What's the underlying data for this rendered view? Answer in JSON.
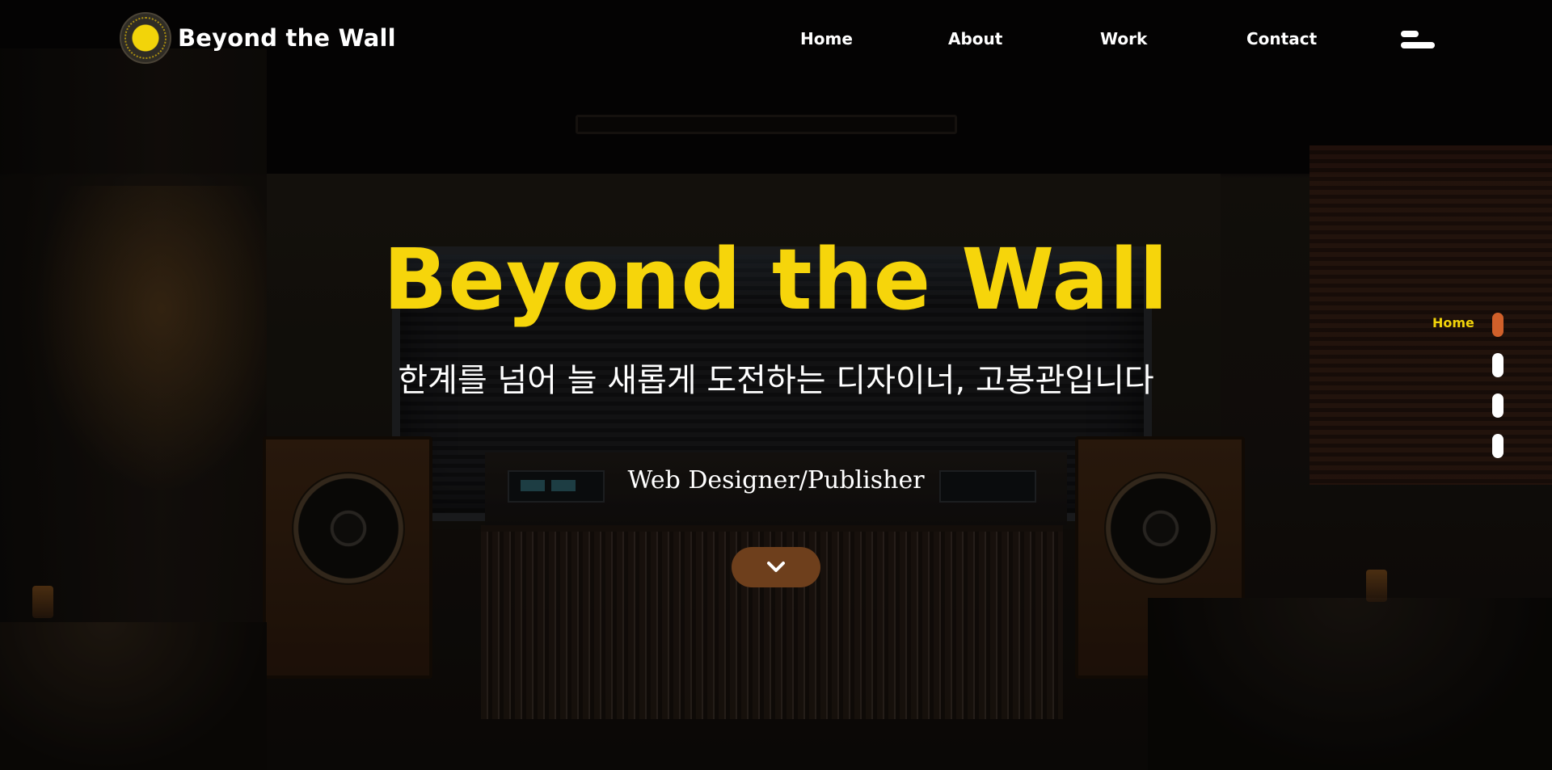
{
  "header": {
    "brand": "Beyond the Wall",
    "logo_icon": "vinyl-record-icon",
    "nav": [
      {
        "label": "Home"
      },
      {
        "label": "About"
      },
      {
        "label": "Work"
      },
      {
        "label": "Contact"
      }
    ],
    "menu_icon": "hamburger-menu-icon"
  },
  "hero": {
    "title": "Beyond the Wall",
    "subtitle": "한계를 넘어 늘 새롭게 도전하는 디자이너, 고봉관입니다",
    "role": "Web Designer/Publisher",
    "scroll_icon": "chevron-down-icon"
  },
  "pagination": {
    "active_label": "Home",
    "active_index": 0,
    "count": 4
  },
  "colors": {
    "accent_yellow": "#f6d50b",
    "scroll_button": "#6e3f1c",
    "active_dot": "#d0602a",
    "text": "#ffffff"
  }
}
